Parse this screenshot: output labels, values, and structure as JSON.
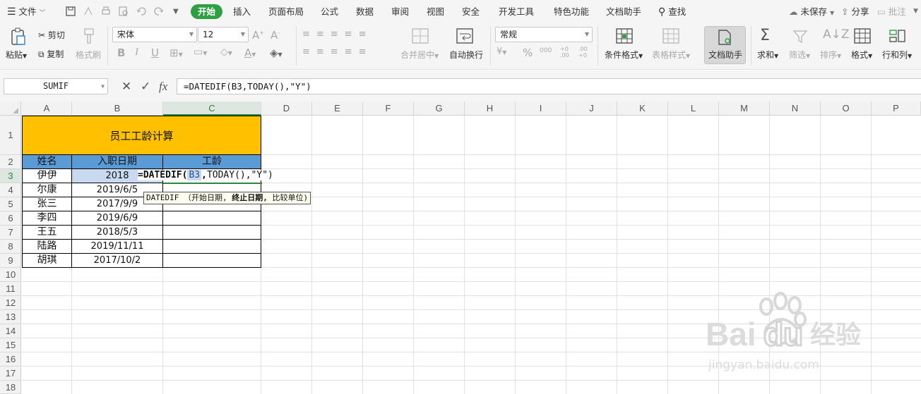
{
  "menu": {
    "file": "文件",
    "tabs": [
      "开始",
      "插入",
      "页面布局",
      "公式",
      "数据",
      "审阅",
      "视图",
      "安全",
      "开发工具",
      "特色功能",
      "文档助手"
    ],
    "search": "查找",
    "unsaved": "未保存",
    "share": "分享",
    "comment": "批注"
  },
  "ribbon": {
    "paste": "粘贴",
    "cut": "剪切",
    "copy": "复制",
    "format_painter": "格式刷",
    "font_name": "宋体",
    "font_size": "12",
    "merge_center": "合并居中",
    "wrap_text": "自动换行",
    "number_format": "常规",
    "conditional_format": "条件格式",
    "table_style": "表格样式",
    "doc_helper": "文档助手",
    "sum": "求和",
    "filter": "筛选",
    "sort": "排序",
    "format": "格式",
    "rows_cols": "行和列",
    "percent": "%",
    "thousands": "000",
    "inc_decimal": "+0 .00",
    "dec_decimal": ".00 +0"
  },
  "formula_bar": {
    "name_box": "SUMIF",
    "formula": "=DATEDIF(B3,TODAY(),\"Y\")"
  },
  "columns": [
    "A",
    "B",
    "C",
    "D",
    "E",
    "F",
    "G",
    "H",
    "I",
    "J",
    "K",
    "L",
    "M",
    "N",
    "O",
    "P"
  ],
  "rows": [
    "1",
    "2",
    "3",
    "4",
    "5",
    "6",
    "7",
    "8",
    "9",
    "10",
    "11",
    "12",
    "13",
    "14",
    "15",
    "16",
    "17",
    "18"
  ],
  "sheet": {
    "title": "员工工龄计算",
    "headers": [
      "姓名",
      "入职日期",
      "工龄"
    ],
    "data": [
      {
        "name": "伊伊",
        "date": "2018"
      },
      {
        "name": "尔康",
        "date": "2019/6/5"
      },
      {
        "name": "张三",
        "date": "2017/9/9"
      },
      {
        "name": "李四",
        "date": "2019/6/9"
      },
      {
        "name": "王五",
        "date": "2018/5/3"
      },
      {
        "name": "陆路",
        "date": "2019/11/11"
      },
      {
        "name": "胡琪",
        "date": "2017/10/2"
      }
    ]
  },
  "in_cell_edit": {
    "prefix": "=DATEDIF(",
    "ref": "B3",
    "suffix1": ",",
    "func2": "TODAY()",
    "suffix2": ",\"Y\")"
  },
  "tooltip": {
    "func": "DATEDIF",
    "args_before": "（开始日期,",
    "arg_current": "终止日期,",
    "args_after": "比较单位)"
  },
  "colors": {
    "accent_green": "#2ea043",
    "title_fill": "#ffc000",
    "header_fill": "#5b9bd5"
  }
}
